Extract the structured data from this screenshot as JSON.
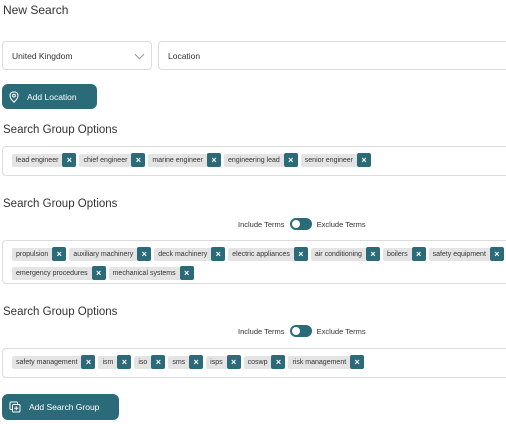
{
  "page": {
    "title": "New Search"
  },
  "country": {
    "value": "United Kingdom"
  },
  "location": {
    "placeholder": "Location"
  },
  "add_location": {
    "label": "Add Location"
  },
  "groups": [
    {
      "heading": "Search Group Options",
      "tags": [
        "lead engineer",
        "chief engineer",
        "marine engineer",
        "engineering lead",
        "senior engineer"
      ]
    },
    {
      "heading": "Search Group Options",
      "include_label": "Include Terms",
      "exclude_label": "Exclude Terms",
      "tags": [
        "propulsion",
        "auxiliary machinery",
        "deck machinery",
        "electric appliances",
        "air conditioning",
        "boilers",
        "safety equipment",
        "emergency procedures",
        "mechanical systems"
      ]
    },
    {
      "heading": "Search Group Options",
      "include_label": "Include Terms",
      "exclude_label": "Exclude Terms",
      "tags": [
        "safety management",
        "ism",
        "iso",
        "sms",
        "isps",
        "coswp",
        "risk management"
      ]
    }
  ],
  "add_group": {
    "label": "Add Search Group"
  },
  "tag_remove_glyph": "×",
  "colors": {
    "accent": "#2b6a78",
    "tag_bg": "#e4e4e4"
  }
}
